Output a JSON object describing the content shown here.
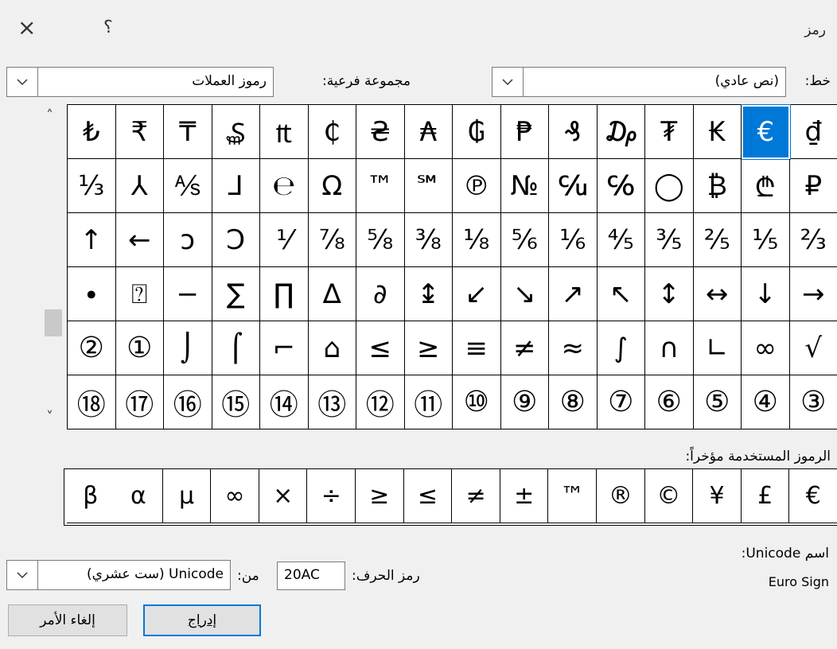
{
  "window": {
    "title": "رمز",
    "close_glyph": "×",
    "help_glyph": "؟"
  },
  "font": {
    "label": "خط:",
    "value": "(نص عادي)"
  },
  "subset": {
    "label": "مجموعة فرعية:",
    "value": "رموز العملات"
  },
  "grid": {
    "rows": [
      [
        "₫",
        "€",
        "₭",
        "₮",
        "₯",
        "₰",
        "₱",
        "₲",
        "₳",
        "₴",
        "₵",
        "₶",
        "₷",
        "₸",
        "₹",
        "₺"
      ],
      [
        "₽",
        "₾",
        "₿",
        "◯",
        "℅",
        "℆",
        "№",
        "℗",
        "℠",
        "™",
        "Ω",
        "℮",
        "⅃",
        "⅍",
        "⅄",
        "⅓"
      ],
      [
        "⅔",
        "⅕",
        "⅖",
        "⅗",
        "⅘",
        "⅙",
        "⅚",
        "⅛",
        "⅜",
        "⅝",
        "⅞",
        "⅟",
        "Ↄ",
        "ↄ",
        "←",
        "↑"
      ],
      [
        "→",
        "↓",
        "↔",
        "↕",
        "↖",
        "↗",
        "↘",
        "↙",
        "↨",
        "∂",
        "∆",
        "∏",
        "∑",
        "−",
        "⍰",
        "∙"
      ],
      [
        "√",
        "∞",
        "∟",
        "∩",
        "∫",
        "≈",
        "≠",
        "≡",
        "≤",
        "≥",
        "⌂",
        "⌐",
        "⌠",
        "⌡",
        "①",
        "②"
      ],
      [
        "③",
        "④",
        "⑤",
        "⑥",
        "⑦",
        "⑧",
        "⑨",
        "⑩",
        "⑪",
        "⑫",
        "⑬",
        "⑭",
        "⑮",
        "⑯",
        "⑰",
        "⑱"
      ]
    ],
    "selected": "€"
  },
  "recent": {
    "label": "الرموز المستخدمة مؤخراً:",
    "items": [
      "€",
      "£",
      "¥",
      "©",
      "®",
      "™",
      "±",
      "≠",
      "≥",
      "≤",
      "÷",
      "×",
      "∞",
      "µ",
      "α",
      "β"
    ]
  },
  "unicode_name": {
    "label": "اسم Unicode:",
    "value": "Euro Sign"
  },
  "char_code": {
    "label": "رمز الحرف:",
    "value": "20AC"
  },
  "from": {
    "label": "من:",
    "value": "Unicode (ست عشري)"
  },
  "buttons": {
    "insert": "إدراج",
    "cancel": "إلغاء الأمر"
  },
  "scroll": {
    "up": "˄",
    "down": "˅"
  }
}
